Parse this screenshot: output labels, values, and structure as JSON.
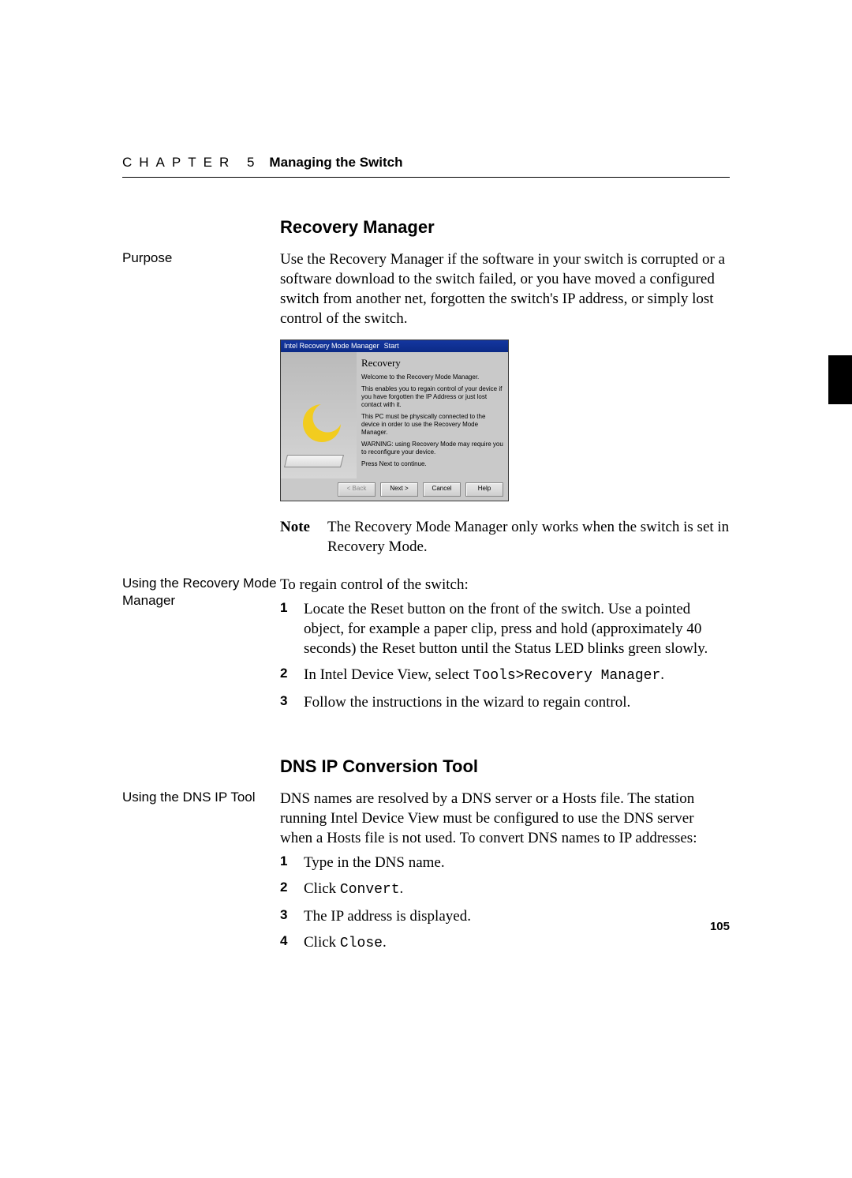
{
  "header": {
    "chapter": "CHAPTER 5",
    "title": "Managing the Switch"
  },
  "section_recovery": {
    "heading": "Recovery Manager",
    "side_purpose": "Purpose",
    "purpose_text": "Use the Recovery Manager if the software in your switch is corrupted or a software download to the switch failed, or you have moved a configured switch from another net, forgotten the switch's IP address, or simply lost control of the switch.",
    "note_label": "Note",
    "note_text": "The Recovery Mode Manager only works when the switch is set in Recovery Mode.",
    "side_using": "Using the Recovery Mode Manager",
    "using_intro": "To regain control of the switch:",
    "steps": [
      "Locate the Reset button on the front of the switch. Use a pointed object, for example a paper clip, press and hold (approximately 40 seconds) the Reset button until the Status LED blinks green slowly.",
      "",
      "Follow the instructions in the wizard to regain control."
    ],
    "step2_prefix": "In Intel Device View, select ",
    "step2_code": "Tools>Recovery Manager",
    "step2_suffix": "."
  },
  "section_dns": {
    "heading": "DNS IP Conversion Tool",
    "side_using": "Using the DNS IP Tool",
    "intro": "DNS names are resolved by a DNS server or a Hosts file. The station running Intel Device View must be configured to use the DNS server when a Hosts file is not used. To convert DNS names to IP addresses:",
    "step1": "Type in the DNS name.",
    "step2_prefix": "Click ",
    "step2_code": "Convert",
    "step2_suffix": ".",
    "step3": "The IP address is displayed.",
    "step4_prefix": "Click ",
    "step4_code": "Close",
    "step4_suffix": "."
  },
  "screenshot": {
    "titlebar1": "Intel Recovery Mode Manager",
    "titlebar2": "Start",
    "heading": "Recovery",
    "welcome": "Welcome to the Recovery Mode Manager.",
    "p1": "This enables you to regain control of your device if you have forgotten the IP Address or just lost contact with it.",
    "p2": "This PC must be physically connected to the device in order to use the Recovery Mode Manager.",
    "p3": "WARNING: using Recovery Mode may require you to reconfigure your device.",
    "p4": "Press Next to continue.",
    "btn_back": "< Back",
    "btn_next": "Next >",
    "btn_cancel": "Cancel",
    "btn_help": "Help"
  },
  "page_number": "105"
}
